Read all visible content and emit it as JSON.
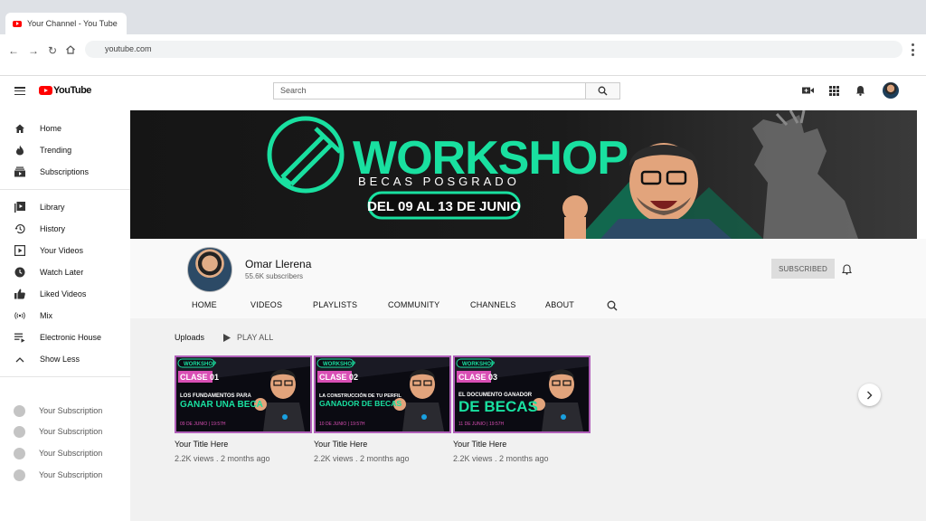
{
  "browser": {
    "tab_title": "Your Channel - You Tube",
    "url": "youtube.com"
  },
  "header": {
    "logo_text": "YouTube",
    "search_placeholder": "Search"
  },
  "sidebar": {
    "primary": [
      {
        "label": "Home",
        "icon": "home-icon"
      },
      {
        "label": "Trending",
        "icon": "fire-icon"
      },
      {
        "label": "Subscriptions",
        "icon": "subscriptions-icon"
      }
    ],
    "secondary": [
      {
        "label": "Library",
        "icon": "library-icon"
      },
      {
        "label": "History",
        "icon": "history-icon"
      },
      {
        "label": "Your Videos",
        "icon": "your-videos-icon"
      },
      {
        "label": "Watch Later",
        "icon": "clock-icon"
      },
      {
        "label": "Liked Videos",
        "icon": "thumbs-up-icon"
      },
      {
        "label": "Mix",
        "icon": "broadcast-icon"
      },
      {
        "label": "Electronic House",
        "icon": "playlist-icon"
      },
      {
        "label": "Show Less",
        "icon": "chevron-up-icon"
      }
    ],
    "subscriptions": [
      {
        "label": "Your Subscription"
      },
      {
        "label": "Your Subscription"
      },
      {
        "label": "Your Subscription"
      },
      {
        "label": "Your Subscription"
      }
    ]
  },
  "banner": {
    "title": "WORKSHOP",
    "subtitle": "BECAS POSGRADO",
    "dates": "DEL 09 AL 13 DE JUNIO"
  },
  "channel": {
    "name": "Omar Llerena",
    "subscribers": "55.6K subscribers",
    "subscribe_label": "SUBSCRIBED",
    "tabs": [
      "HOME",
      "VIDEOS",
      "PLAYLISTS",
      "COMMUNITY",
      "CHANNELS",
      "ABOUT"
    ]
  },
  "uploads": {
    "section_label": "Uploads",
    "play_all_label": "PLAY ALL",
    "videos": [
      {
        "badge": "WORKSHOP",
        "clase": "CLASE 01",
        "line1": "LOS FUNDAMENTOS PARA",
        "line2": "GANAR UNA BECA",
        "date": "09 DE JUNIO | 19:57H",
        "title": "Your Title Here",
        "meta": "2.2K views . 2 months ago"
      },
      {
        "badge": "WORKSHOP",
        "clase": "CLASE 02",
        "line1": "LA CONSTRUCCIÓN DE TU PERFIL",
        "line2": "GANADOR DE BECAS",
        "date": "10 DE JUNIO | 19:57H",
        "title": "Your Title Here",
        "meta": "2.2K views . 2 months ago"
      },
      {
        "badge": "WORKSHOP",
        "clase": "CLASE 03",
        "line1": "EL DOCUMENTO GANADOR",
        "line2": "DE BECAS",
        "date": "11 DE JUNIO | 19:57H",
        "title": "Your Title Here",
        "meta": "2.2K views . 2 months ago"
      }
    ]
  },
  "colors": {
    "brand_red": "#ff0000",
    "banner_green": "#19e0a0",
    "thumb_border": "#b05fb9",
    "thumb_pink": "#d94fb5"
  }
}
